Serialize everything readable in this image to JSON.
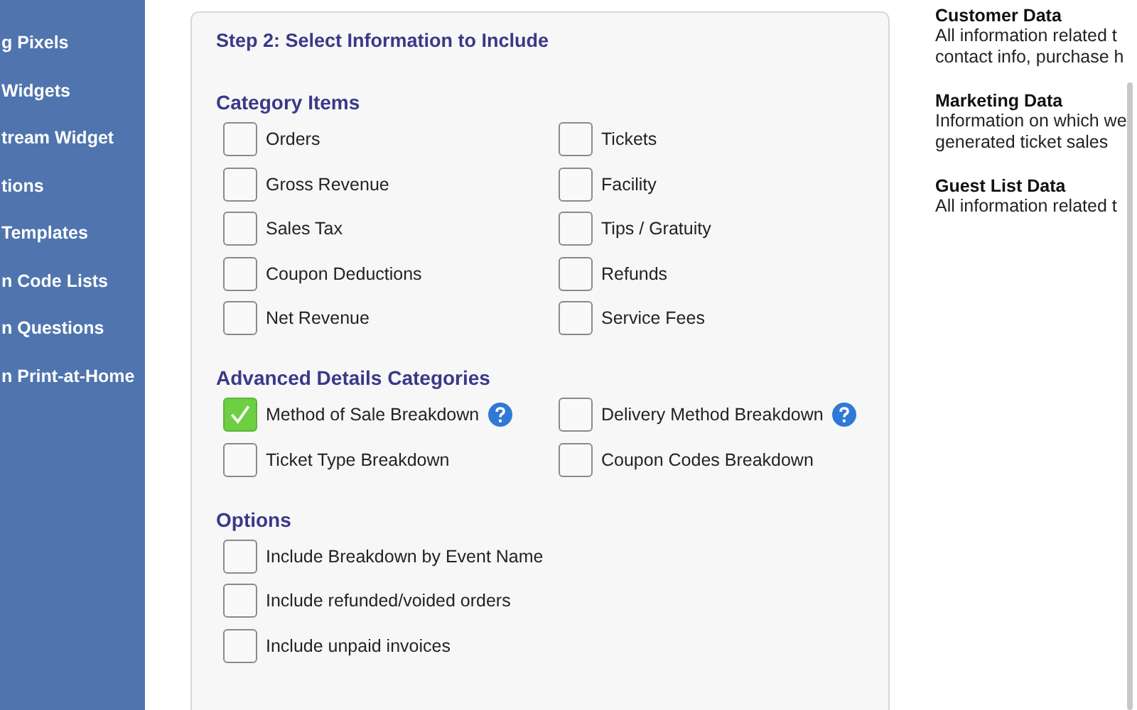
{
  "sidebar": {
    "items": [
      "g Pixels",
      "Widgets",
      "tream Widget",
      "tions",
      "Templates",
      "n Code Lists",
      "n Questions",
      "n Print-at-Home"
    ]
  },
  "panel": {
    "title": "Step 2: Select Information to Include",
    "sections": [
      {
        "heading": "Category Items",
        "kind": "pairs",
        "items": [
          {
            "label": "Orders",
            "checked": false
          },
          {
            "label": "Tickets",
            "checked": false
          },
          {
            "label": "Gross Revenue",
            "checked": false
          },
          {
            "label": "Facility",
            "checked": false
          },
          {
            "label": "Sales Tax",
            "checked": false
          },
          {
            "label": "Tips / Gratuity",
            "checked": false
          },
          {
            "label": "Coupon Deductions",
            "checked": false
          },
          {
            "label": "Refunds",
            "checked": false
          },
          {
            "label": "Net Revenue",
            "checked": false
          },
          {
            "label": "Service Fees",
            "checked": false
          }
        ]
      },
      {
        "heading": "Advanced Details Categories",
        "kind": "pairs",
        "items": [
          {
            "label": "Method of Sale Breakdown",
            "checked": true,
            "help": true
          },
          {
            "label": "Delivery Method Breakdown",
            "checked": false,
            "help": true
          },
          {
            "label": "Ticket Type Breakdown",
            "checked": false
          },
          {
            "label": "Coupon Codes Breakdown",
            "checked": false
          }
        ]
      },
      {
        "heading": "Options",
        "kind": "list",
        "items": [
          {
            "label": "Include Breakdown by Event Name",
            "checked": false
          },
          {
            "label": "Include refunded/voided orders",
            "checked": false
          },
          {
            "label": "Include unpaid invoices",
            "checked": false
          }
        ]
      }
    ]
  },
  "info": [
    {
      "title": "Customer Data",
      "lines": [
        "All information related t",
        "contact info, purchase h"
      ]
    },
    {
      "title": "Marketing Data",
      "lines": [
        "Information on which we",
        "generated ticket sales"
      ]
    },
    {
      "title": "Guest List Data",
      "lines": [
        "All information related t"
      ]
    }
  ]
}
